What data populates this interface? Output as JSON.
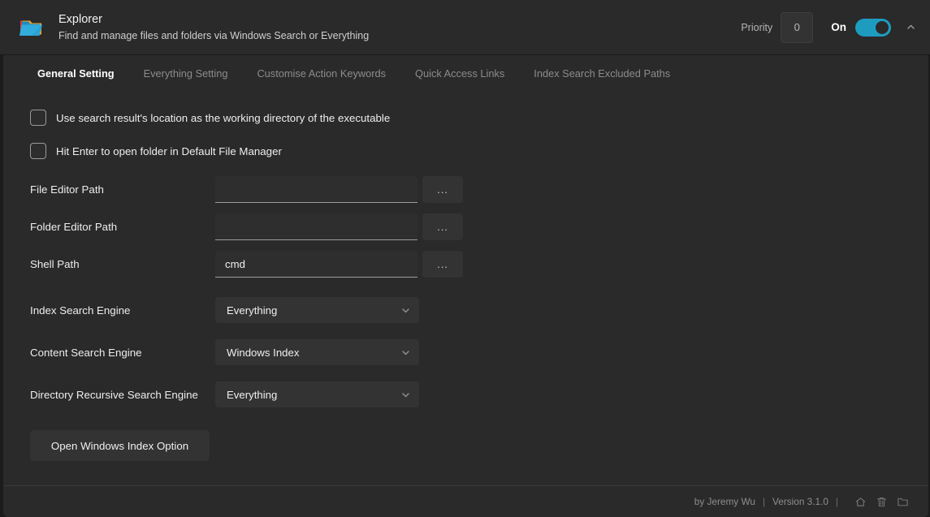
{
  "header": {
    "icon": "folder-color-icon",
    "title": "Explorer",
    "subtitle": "Find and manage files and folders via Windows Search or Everything",
    "priority_label": "Priority",
    "priority_value": "0",
    "toggle_label": "On",
    "toggle_state": "on",
    "toggle_color": "#1d9cc0",
    "collapse_icon": "chevron-up-icon"
  },
  "tabs": [
    {
      "label": "General Setting",
      "active": true
    },
    {
      "label": "Everything Setting",
      "active": false
    },
    {
      "label": "Customise Action Keywords",
      "active": false
    },
    {
      "label": "Quick Access Links",
      "active": false
    },
    {
      "label": "Index Search Excluded Paths",
      "active": false
    }
  ],
  "checkboxes": [
    {
      "label": "Use search result's location as the working directory of the executable",
      "checked": false
    },
    {
      "label": "Hit Enter to open folder in Default File Manager",
      "checked": false
    }
  ],
  "path_fields": [
    {
      "label": "File Editor Path",
      "value": "",
      "placeholder": "",
      "browse_label": "..."
    },
    {
      "label": "Folder Editor Path",
      "value": "",
      "placeholder": "",
      "browse_label": "..."
    },
    {
      "label": "Shell Path",
      "value": "cmd",
      "placeholder": "",
      "browse_label": "..."
    }
  ],
  "selects": [
    {
      "label": "Index Search Engine",
      "value": "Everything",
      "icon": "chevron-down-icon"
    },
    {
      "label": "Content Search Engine",
      "value": "Windows Index",
      "icon": "chevron-down-icon"
    },
    {
      "label": "Directory Recursive Search Engine",
      "value": "Everything",
      "icon": "chevron-down-icon"
    }
  ],
  "action_button": {
    "label": "Open Windows Index Option"
  },
  "footer": {
    "author": "by  Jeremy Wu",
    "sep1": "|",
    "version": "Version 3.1.0",
    "sep2": "|",
    "icons": [
      "home-icon",
      "trash-icon",
      "folder-icon"
    ]
  },
  "colors": {
    "window_bg": "#1b1b1b",
    "panel_bg": "#2a2a2a",
    "control_bg": "#333333",
    "accent": "#1d9cc0",
    "text_primary": "#f0f0f0",
    "text_muted": "#8c8c8c"
  }
}
